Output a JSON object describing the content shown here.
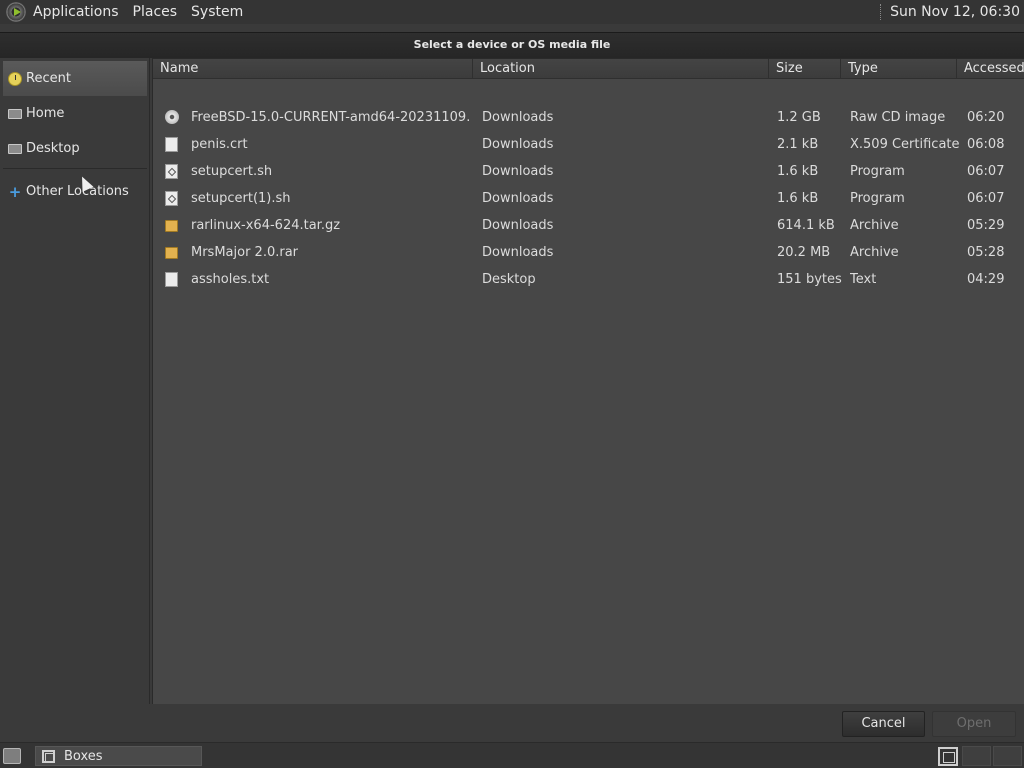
{
  "top_panel": {
    "menus": [
      "Applications",
      "Places",
      "System"
    ],
    "clock": "Sun Nov 12, 06:30"
  },
  "dialog": {
    "title": "Select a device or OS media file",
    "sidebar": {
      "items": [
        {
          "label": "Recent",
          "icon": "recent-icon",
          "active": true
        },
        {
          "label": "Home",
          "icon": "home-folder-icon",
          "active": false
        },
        {
          "label": "Desktop",
          "icon": "desktop-folder-icon",
          "active": false
        },
        {
          "label": "Other Locations",
          "icon": "plus-icon",
          "active": false
        }
      ]
    },
    "columns": [
      "Name",
      "Location",
      "Size",
      "Type",
      "Accessed"
    ],
    "files": [
      {
        "name": "FreeBSD-15.0-CURRENT-amd64-20231109…",
        "location": "Downloads",
        "size": "1.2 GB",
        "type": "Raw CD image",
        "accessed": "06:20",
        "icon": "disc-image-icon"
      },
      {
        "name": "penis.crt",
        "location": "Downloads",
        "size": "2.1 kB",
        "type": "X.509 Certificate",
        "accessed": "06:08",
        "icon": "document-icon"
      },
      {
        "name": "setupcert.sh",
        "location": "Downloads",
        "size": "1.6 kB",
        "type": "Program",
        "accessed": "06:07",
        "icon": "program-icon"
      },
      {
        "name": "setupcert(1).sh",
        "location": "Downloads",
        "size": "1.6 kB",
        "type": "Program",
        "accessed": "06:07",
        "icon": "program-icon"
      },
      {
        "name": "rarlinux-x64-624.tar.gz",
        "location": "Downloads",
        "size": "614.1 kB",
        "type": "Archive",
        "accessed": "05:29",
        "icon": "archive-icon"
      },
      {
        "name": "MrsMajor 2.0.rar",
        "location": "Downloads",
        "size": "20.2 MB",
        "type": "Archive",
        "accessed": "05:28",
        "icon": "archive-icon"
      },
      {
        "name": "assholes.txt",
        "location": "Desktop",
        "size": "151 bytes",
        "type": "Text",
        "accessed": "04:29",
        "icon": "text-file-icon"
      }
    ],
    "buttons": {
      "cancel": "Cancel",
      "open": "Open"
    }
  },
  "taskbar": {
    "tasks": [
      {
        "label": "Boxes",
        "icon": "boxes-app-icon"
      }
    ]
  }
}
